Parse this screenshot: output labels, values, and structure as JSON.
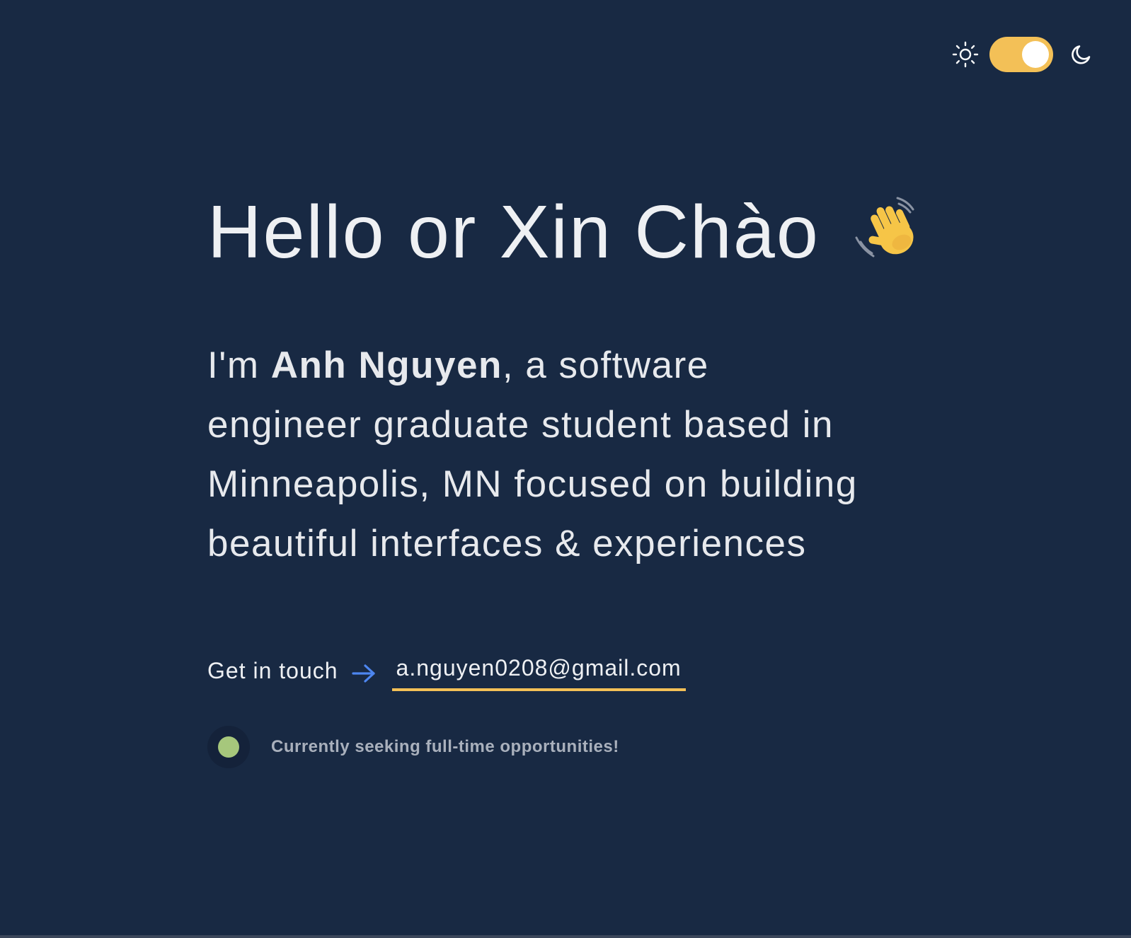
{
  "theme": {
    "toggle_state": "dark",
    "accent_color": "#f3c057",
    "background_color": "#182943",
    "sun_icon": "sun-icon",
    "moon_icon": "moon-icon"
  },
  "hero": {
    "title": "Hello or Xin Chào",
    "wave_icon": "waving-hand-icon",
    "intro_prefix": "I'm ",
    "name": "Anh Nguyen",
    "intro_suffix": ", a software engineer graduate student based in Minneapolis, MN focused on building beautiful interfaces & experiences"
  },
  "contact": {
    "label": "Get in touch",
    "arrow_icon": "arrow-right-icon",
    "email": "a.nguyen0208@gmail.com"
  },
  "status": {
    "text": "Currently seeking full-time opportunities!",
    "dot_color": "#a6c77c"
  }
}
